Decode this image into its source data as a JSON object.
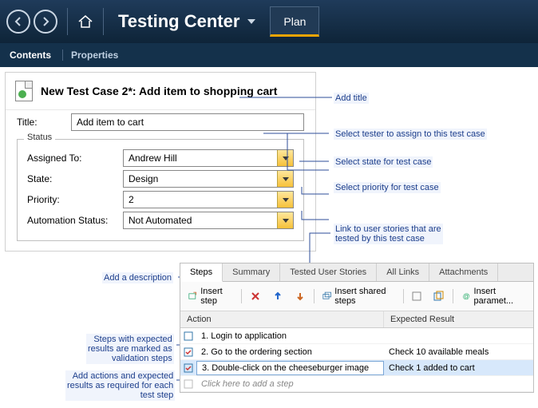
{
  "appbar": {
    "title": "Testing Center",
    "plan_tab": "Plan"
  },
  "secnav": {
    "contents": "Contents",
    "properties": "Properties"
  },
  "panel": {
    "title": "New Test Case 2*: Add item to shopping cart",
    "title_label": "Title:",
    "title_value": "Add item to cart",
    "status_legend": "Status",
    "fields": {
      "assigned_label": "Assigned To:",
      "assigned_value": "Andrew Hill",
      "state_label": "State:",
      "state_value": "Design",
      "priority_label": "Priority:",
      "priority_value": "2",
      "automation_label": "Automation Status:",
      "automation_value": "Not Automated"
    }
  },
  "callouts": {
    "add_title": "Add title",
    "select_tester": "Select tester to assign to this test case",
    "select_state": "Select state for test case",
    "select_priority": "Select priority for test case",
    "link_stories_l1": "Link to user stories that are",
    "link_stories_l2": "tested by this test case",
    "add_desc": "Add a description",
    "validation_l1": "Steps with expected",
    "validation_l2": "results are marked as",
    "validation_l3": "validation steps",
    "add_actions_l1": "Add actions and expected",
    "add_actions_l2": "results as required for each",
    "add_actions_l3": "test step"
  },
  "steps": {
    "tabs": {
      "steps": "Steps",
      "summary": "Summary",
      "tested_user_stories": "Tested User Stories",
      "all_links": "All Links",
      "attachments": "Attachments"
    },
    "toolbar": {
      "insert_step": "Insert step",
      "insert_shared": "Insert shared steps",
      "insert_param": "Insert paramet..."
    },
    "columns": {
      "action": "Action",
      "expected": "Expected Result"
    },
    "rows": [
      {
        "action": "1. Login to application",
        "expected": "",
        "validation": false
      },
      {
        "action": "2. Go to the ordering section",
        "expected": "Check 10 available meals",
        "validation": true
      },
      {
        "action": "3. Double-click on the cheeseburger image",
        "expected": "Check 1 added to cart",
        "validation": true
      }
    ],
    "placeholder": "Click here to add a step"
  }
}
